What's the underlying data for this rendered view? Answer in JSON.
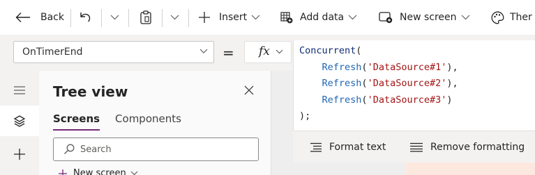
{
  "toolbar": {
    "back_label": "Back",
    "insert_label": "Insert",
    "add_data_label": "Add data",
    "new_screen_label": "New screen",
    "theme_label": "Ther"
  },
  "formula_bar": {
    "property": "OnTimerEnd",
    "equals": "=",
    "fx_label": "fx"
  },
  "code_lines": [
    [
      {
        "t": "Concurrent",
        "c": "ident"
      },
      {
        "t": "(",
        "c": "punc"
      }
    ],
    [
      {
        "t": "    ",
        "c": "punc"
      },
      {
        "t": "Refresh",
        "c": "func"
      },
      {
        "t": "(",
        "c": "punc"
      },
      {
        "t": "'DataSource#1'",
        "c": "str"
      },
      {
        "t": "),",
        "c": "punc"
      }
    ],
    [
      {
        "t": "    ",
        "c": "punc"
      },
      {
        "t": "Refresh",
        "c": "func"
      },
      {
        "t": "(",
        "c": "punc"
      },
      {
        "t": "'DataSource#2'",
        "c": "str"
      },
      {
        "t": "),",
        "c": "punc"
      }
    ],
    [
      {
        "t": "    ",
        "c": "punc"
      },
      {
        "t": "Refresh",
        "c": "func"
      },
      {
        "t": "(",
        "c": "punc"
      },
      {
        "t": "'DataSource#3'",
        "c": "str"
      },
      {
        "t": ")",
        "c": "punc"
      }
    ],
    [
      {
        "t": ");",
        "c": "punc"
      }
    ]
  ],
  "editor_toolbar": {
    "format_text_label": "Format text",
    "remove_formatting_label": "Remove formatting"
  },
  "tree_view": {
    "title": "Tree view",
    "tabs": [
      {
        "label": "Screens",
        "active": true
      },
      {
        "label": "Components",
        "active": false
      }
    ],
    "search_placeholder": "Search",
    "new_screen_label": "New screen"
  },
  "rail": {
    "items": [
      "menu-icon",
      "layers-icon",
      "plus-icon"
    ],
    "active": "layers-icon"
  },
  "colors": {
    "accent": "#742774",
    "code_function": "#1d66b5",
    "code_string": "#a31515",
    "code_identifier": "#0f2d73"
  }
}
